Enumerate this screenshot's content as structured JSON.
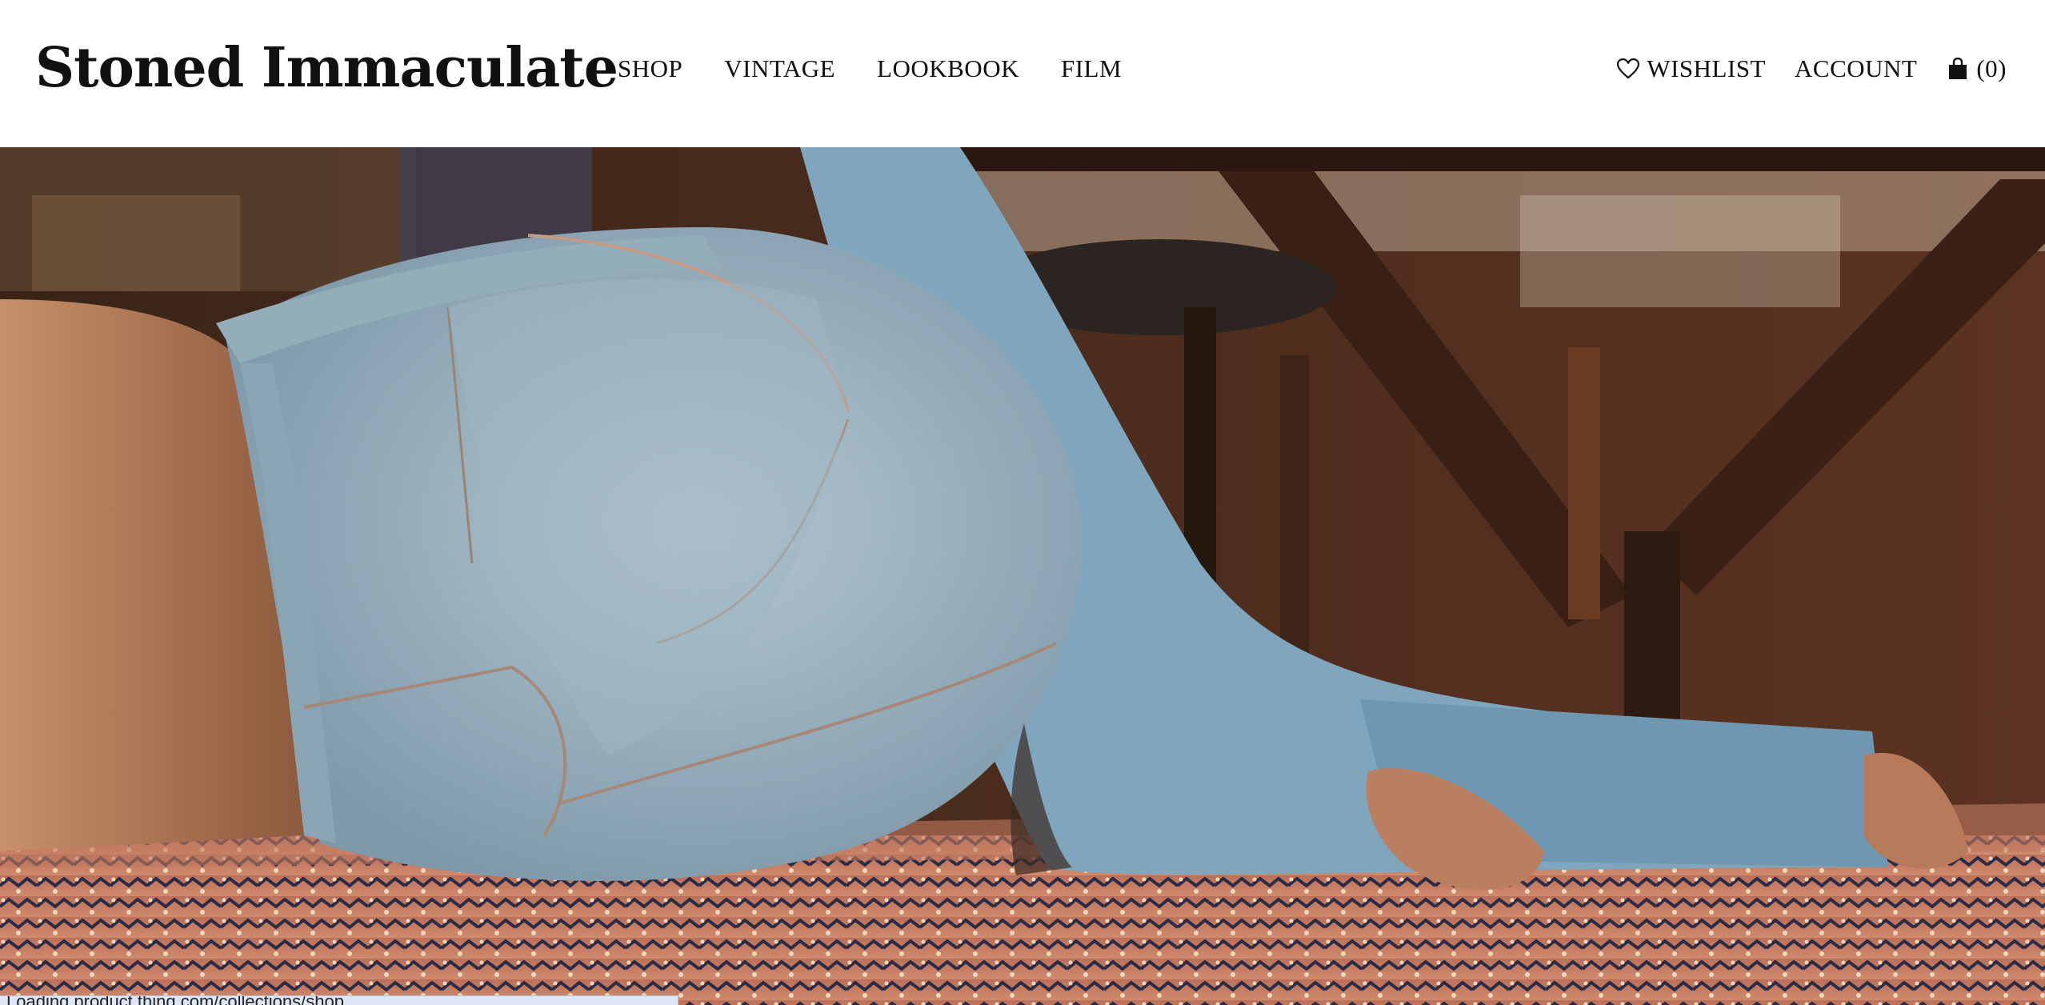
{
  "brand": {
    "logo_text": "Stoned Immaculate"
  },
  "nav": {
    "items": [
      {
        "label": "SHOP"
      },
      {
        "label": "VINTAGE"
      },
      {
        "label": "LOOKBOOK"
      },
      {
        "label": "FILM"
      }
    ]
  },
  "utils": {
    "wishlist_label": "WISHLIST",
    "account_label": "ACCOUNT",
    "cart_count_label": "(0)"
  },
  "status_bar": {
    "text": "Loading product thing.com/collections/shop..."
  },
  "icons": [
    "heart-icon",
    "shopping-bag-icon"
  ],
  "colors": {
    "text": "#111111",
    "background": "#ffffff",
    "hero_dark": "#4a2b1c",
    "denim": "#8fb0c4",
    "rug": "#c26a47"
  }
}
